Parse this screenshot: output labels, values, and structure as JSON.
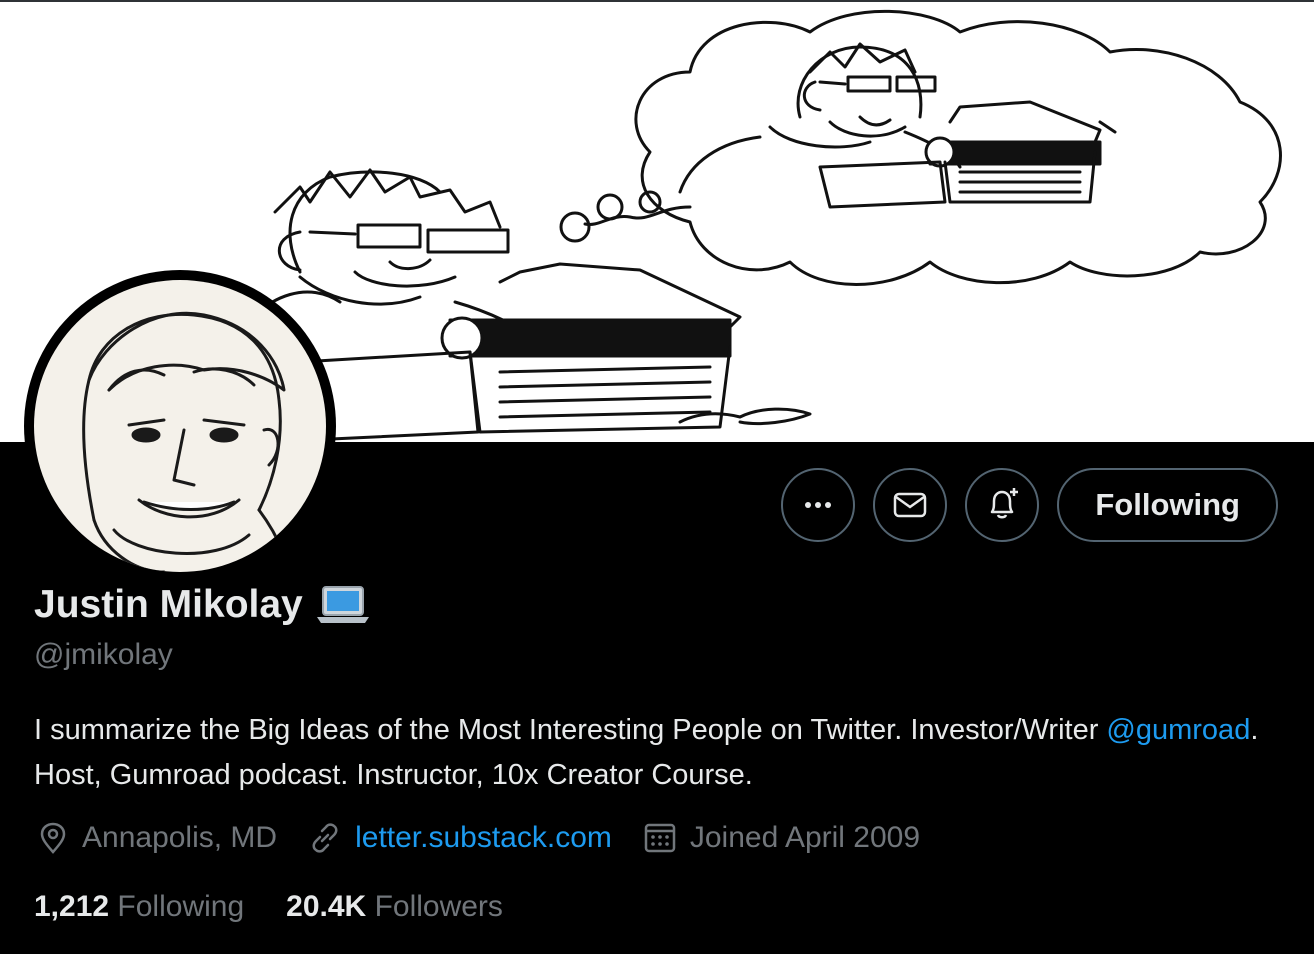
{
  "profile": {
    "display_name": "Justin Mikolay",
    "display_emoji": "laptop-emoji",
    "handle": "@jmikolay",
    "bio_part1": "I summarize the Big Ideas of the Most Interesting People on Twitter. Investor/Writer ",
    "bio_mention": "@gumroad",
    "bio_part2": ". Host, Gumroad podcast. Instructor, 10x Creator Course.",
    "location": "Annapolis, MD",
    "website": "letter.substack.com",
    "joined": "Joined April 2009"
  },
  "stats": {
    "following_count": "1,212",
    "following_label": "Following",
    "followers_count": "20.4K",
    "followers_label": "Followers"
  },
  "actions": {
    "more_icon": "ellipsis-icon",
    "message_icon": "envelope-icon",
    "notify_icon": "bell-plus-icon",
    "follow_label": "Following"
  },
  "colors": {
    "background": "#000000",
    "text_primary": "#e7e9ea",
    "text_secondary": "#71767b",
    "accent": "#1d9bf0",
    "button_border": "#536471"
  }
}
